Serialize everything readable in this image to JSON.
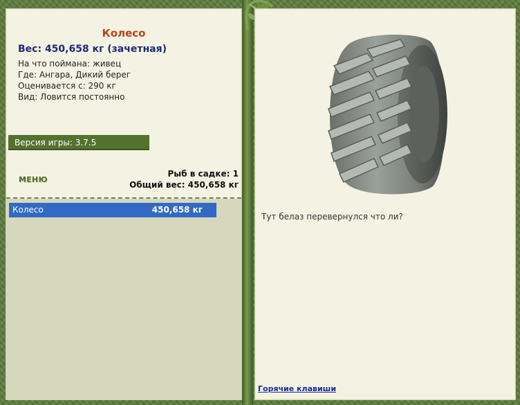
{
  "fish": {
    "name": "Колесо",
    "weight_line": "Вес: 450,658 кг (зачетная)",
    "bait": "На что поймана: живец",
    "location": "Где: Ангара, Дикий берег",
    "valued_from": "Оценивается с: 290 кг",
    "kind": "Вид: Ловится постоянно"
  },
  "game": {
    "version_label": "Версия игры: 3.7.5"
  },
  "menu": {
    "label": "МЕНЮ"
  },
  "cage": {
    "count_label": "Рыб в садке: 1",
    "total_label": "Общий вес: 450,658 кг",
    "items": [
      {
        "name": "Колесо",
        "weight": "450,658 кг"
      }
    ]
  },
  "detail": {
    "image_icon": "tire-image",
    "description": "Тут белаз перевернулся что ли?"
  },
  "footer": {
    "hotkeys_label": "Горячие клавиши"
  },
  "colors": {
    "frame": "#5d7c3c",
    "panel": "#f4f3e3",
    "title": "#b5431a",
    "weight": "#1c2a7a",
    "selection": "#3169c4",
    "link": "#1a2a9a"
  }
}
